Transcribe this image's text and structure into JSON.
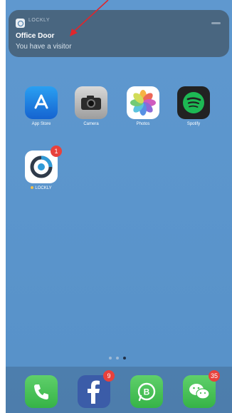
{
  "notification": {
    "app_name": "LOCKLY",
    "title": "Office Door",
    "body": "You have a visitor"
  },
  "apps": [
    {
      "label": "App Store",
      "icon": "app-store-icon"
    },
    {
      "label": "Camera",
      "icon": "camera-icon"
    },
    {
      "label": "Photos",
      "icon": "photos-icon"
    },
    {
      "label": "Spotify",
      "icon": "spotify-icon"
    },
    {
      "label": "LOCKLY",
      "icon": "lockly-icon",
      "badge": "1"
    }
  ],
  "page_indicator": {
    "pages": 3,
    "current": 3
  },
  "dock": [
    {
      "icon": "phone-icon"
    },
    {
      "icon": "facebook-icon",
      "badge": "9"
    },
    {
      "icon": "whatsapp-business-icon"
    },
    {
      "icon": "wechat-icon",
      "badge": "35"
    }
  ],
  "colors": {
    "badge": "#e8413c",
    "annotation_arrow": "#e0262b"
  }
}
